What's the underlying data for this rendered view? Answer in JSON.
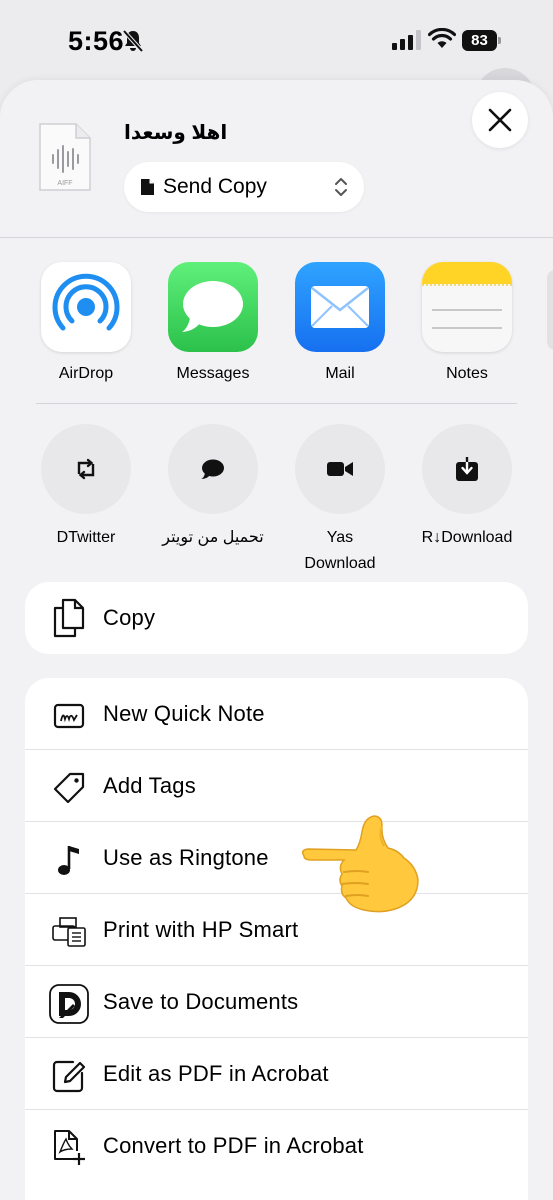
{
  "status_bar": {
    "time": "5:56",
    "battery": "83"
  },
  "header": {
    "file_title": "اهلا وسعدا",
    "file_type": "AIFF",
    "send_mode": "Send Copy"
  },
  "apps": [
    {
      "label": "AirDrop"
    },
    {
      "label": "Messages"
    },
    {
      "label": "Mail"
    },
    {
      "label": "Notes"
    }
  ],
  "shortcuts": [
    {
      "label": "DTwitter"
    },
    {
      "label": "تحميل من تويتر"
    },
    {
      "label": "Yas Download"
    },
    {
      "label": "R↓Download"
    }
  ],
  "copy_label": "Copy",
  "actions": [
    {
      "label": "New Quick Note",
      "icon": "quick-note-icon"
    },
    {
      "label": "Add Tags",
      "icon": "tag-icon"
    },
    {
      "label": "Use as Ringtone",
      "icon": "music-note-icon"
    },
    {
      "label": "Print with HP Smart",
      "icon": "printer-icon"
    },
    {
      "label": "Save to Documents",
      "icon": "documents-app-icon"
    },
    {
      "label": "Edit as PDF in Acrobat",
      "icon": "edit-pdf-icon"
    },
    {
      "label": "Convert to PDF in Acrobat",
      "icon": "convert-pdf-icon"
    }
  ],
  "colors": {
    "sheet_bg": "#f2f2f4",
    "messages_green": "#34c759",
    "mail_blue": "#1a8cff",
    "notes_yellow": "#ffd426",
    "airdrop_blue": "#1f8ef1"
  }
}
